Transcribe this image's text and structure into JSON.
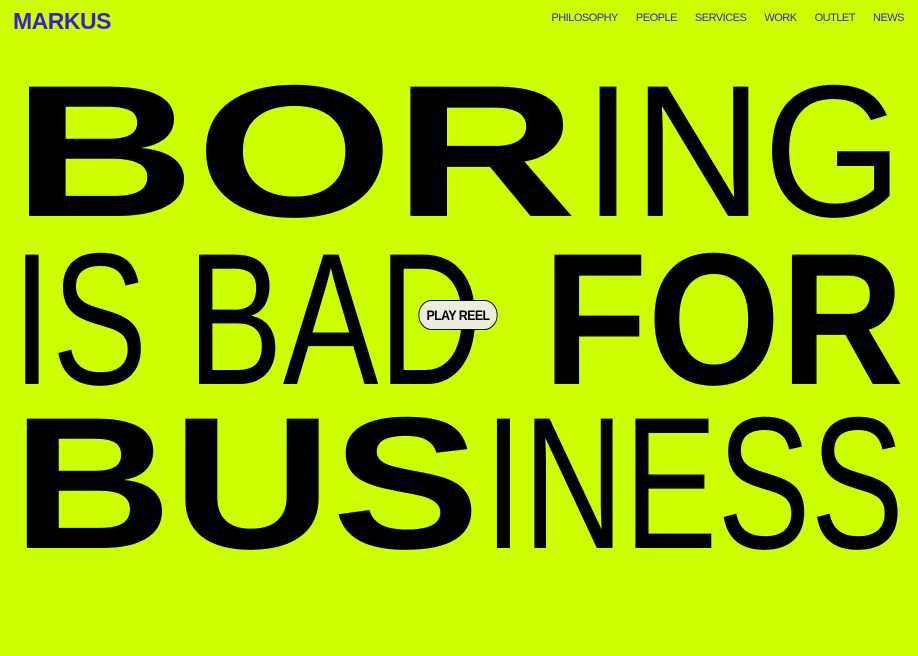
{
  "brand": {
    "logo": "MARKUS",
    "logo_color": "#3b1fd1",
    "background_color": "#ccff00"
  },
  "nav": {
    "items": [
      "PHILOSOPHY",
      "PEOPLE",
      "SERVICES",
      "WORK",
      "OUTLET",
      "NEWS"
    ]
  },
  "hero": {
    "line1": {
      "bold": "BOR",
      "light": "ING"
    },
    "line2": {
      "light": "IS BAD",
      "bold": "FOR"
    },
    "line3": {
      "bold": "BUS",
      "light": "INESS"
    }
  },
  "reel_button": {
    "label": "PLAY REEL"
  }
}
